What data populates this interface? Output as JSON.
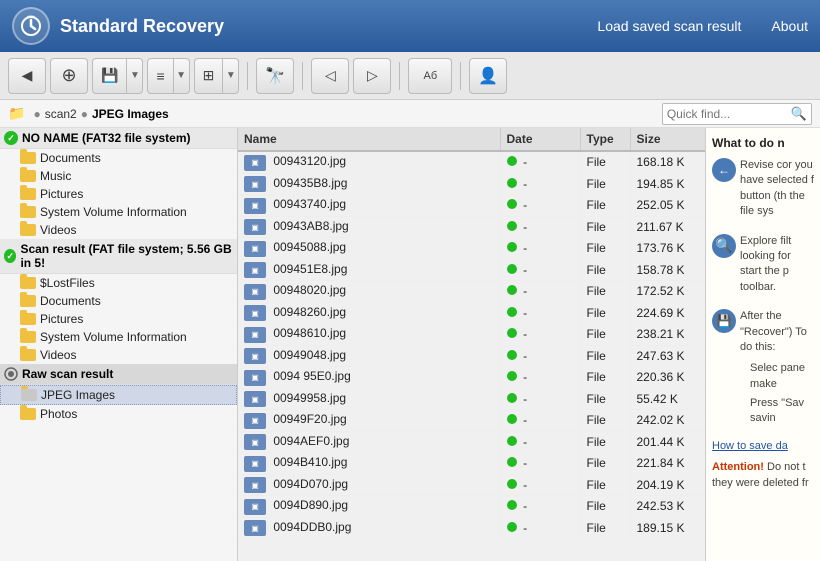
{
  "header": {
    "title": "Standard Recovery",
    "nav": {
      "load_scan": "Load saved scan result",
      "about": "About"
    }
  },
  "toolbar": {
    "buttons": [
      {
        "name": "back-button",
        "label": "◀",
        "has_dropdown": false
      },
      {
        "name": "search-button",
        "label": "⌕",
        "has_dropdown": false
      },
      {
        "name": "save-button",
        "label": "💾",
        "has_dropdown": true
      },
      {
        "name": "list-button",
        "label": "≡",
        "has_dropdown": true
      },
      {
        "name": "grid-button",
        "label": "⊞",
        "has_dropdown": true
      },
      {
        "name": "binoculars-button",
        "label": "⌖",
        "has_dropdown": false
      },
      {
        "name": "prev-button",
        "label": "◁",
        "has_dropdown": false
      },
      {
        "name": "next-button",
        "label": "▷",
        "has_dropdown": false
      },
      {
        "name": "font-button",
        "label": "Аб",
        "has_dropdown": false
      },
      {
        "name": "person-button",
        "label": "👤",
        "has_dropdown": false
      }
    ]
  },
  "breadcrumb": {
    "items": [
      "scan2",
      "JPEG Images"
    ],
    "quick_find_placeholder": "Quick find..."
  },
  "tree": {
    "volumes": [
      {
        "id": "no-name-volume",
        "label": "NO NAME (FAT32 file system)",
        "children": [
          {
            "id": "documents-1",
            "label": "Documents"
          },
          {
            "id": "music-1",
            "label": "Music"
          },
          {
            "id": "pictures-1",
            "label": "Pictures"
          },
          {
            "id": "system-volume-1",
            "label": "System Volume Information"
          },
          {
            "id": "videos-1",
            "label": "Videos"
          }
        ]
      },
      {
        "id": "scan-result-volume",
        "label": "Scan result (FAT file system; 5.56 GB in 5!",
        "children": [
          {
            "id": "lost-files",
            "label": "$LostFiles"
          },
          {
            "id": "documents-2",
            "label": "Documents"
          },
          {
            "id": "pictures-2",
            "label": "Pictures"
          },
          {
            "id": "system-volume-2",
            "label": "System Volume Information"
          },
          {
            "id": "videos-2",
            "label": "Videos"
          }
        ]
      }
    ],
    "raw_scan": {
      "label": "Raw scan result",
      "children": [
        {
          "id": "jpeg-images",
          "label": "JPEG Images",
          "selected": true
        },
        {
          "id": "photos",
          "label": "Photos"
        }
      ]
    }
  },
  "file_table": {
    "headers": [
      "Name",
      "Date",
      "Type",
      "Size"
    ],
    "rows": [
      {
        "name": "00943120.jpg",
        "date": "-",
        "type": "File",
        "size": "168.18 K"
      },
      {
        "name": "009435B8.jpg",
        "date": "-",
        "type": "File",
        "size": "194.85 K"
      },
      {
        "name": "00943740.jpg",
        "date": "-",
        "type": "File",
        "size": "252.05 K"
      },
      {
        "name": "00943AB8.jpg",
        "date": "-",
        "type": "File",
        "size": "211.67 K"
      },
      {
        "name": "00945088.jpg",
        "date": "-",
        "type": "File",
        "size": "173.76 K"
      },
      {
        "name": "009451E8.jpg",
        "date": "-",
        "type": "File",
        "size": "158.78 K"
      },
      {
        "name": "00948020.jpg",
        "date": "-",
        "type": "File",
        "size": "172.52 K"
      },
      {
        "name": "00948260.jpg",
        "date": "-",
        "type": "File",
        "size": "224.69 K"
      },
      {
        "name": "00948610.jpg",
        "date": "-",
        "type": "File",
        "size": "238.21 K"
      },
      {
        "name": "00949048.jpg",
        "date": "-",
        "type": "File",
        "size": "247.63 K"
      },
      {
        "name": "0094 95E0.jpg",
        "date": "-",
        "type": "File",
        "size": "220.36 K"
      },
      {
        "name": "00949958.jpg",
        "date": "-",
        "type": "File",
        "size": "55.42 K"
      },
      {
        "name": "00949F20.jpg",
        "date": "-",
        "type": "File",
        "size": "242.02 K"
      },
      {
        "name": "0094AEF0.jpg",
        "date": "-",
        "type": "File",
        "size": "201.44 K"
      },
      {
        "name": "0094B410.jpg",
        "date": "-",
        "type": "File",
        "size": "221.84 K"
      },
      {
        "name": "0094D070.jpg",
        "date": "-",
        "type": "File",
        "size": "204.19 K"
      },
      {
        "name": "0094D890.jpg",
        "date": "-",
        "type": "File",
        "size": "242.53 K"
      },
      {
        "name": "0094DDB0.jpg",
        "date": "-",
        "type": "File",
        "size": "189.15 K"
      }
    ]
  },
  "info_panel": {
    "title": "What to do n",
    "section1": "Revise cor you have selected f button (th the file sys",
    "section2": "Explore filt looking for start the p toolbar.",
    "section3": "After the \"Recover\") To do this:",
    "bullet1": "Selec pane make",
    "bullet2": "Press \"Sav savin",
    "link": "How to save da",
    "attention_label": "Attention!",
    "attention_text": " Do not t they were deleted fr"
  }
}
